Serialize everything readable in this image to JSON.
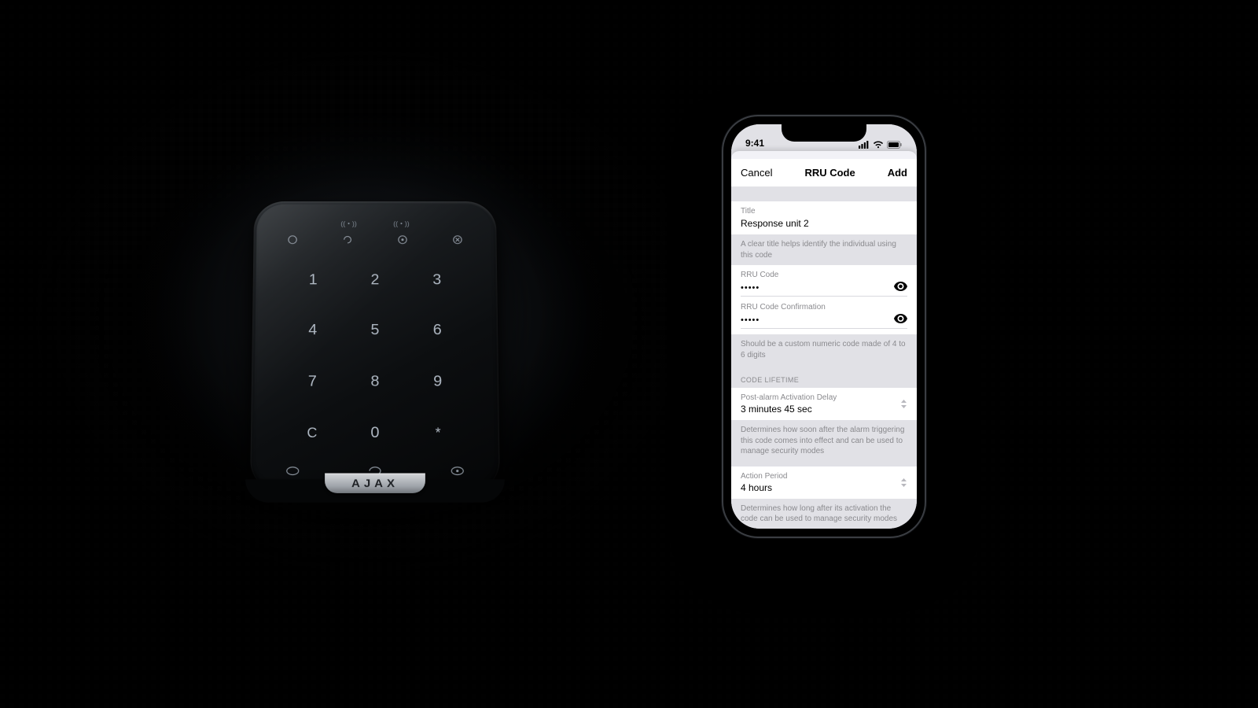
{
  "statusbar": {
    "time": "9:41"
  },
  "keypad": {
    "brand": "AJAX",
    "keys": {
      "k1": "1",
      "k2": "2",
      "k3": "3",
      "k4": "4",
      "k5": "5",
      "k6": "6",
      "k7": "7",
      "k8": "8",
      "k9": "9",
      "kc": "C",
      "k0": "0",
      "kstar": "*"
    }
  },
  "modal": {
    "cancel": "Cancel",
    "title": "RRU Code",
    "add": "Add",
    "title_field": {
      "label": "Title",
      "value": "Response unit 2"
    },
    "title_hint": "A clear title helps identify the individual using this code",
    "code_field": {
      "label": "RRU Code",
      "value_masked": "•••••"
    },
    "code_confirm_field": {
      "label": "RRU Code Confirmation",
      "value_masked": "•••••"
    },
    "code_hint": "Should be a custom numeric code made of 4 to 6 digits",
    "lifetime_header": "CODE LIFETIME",
    "delay": {
      "label": "Post-alarm Activation Delay",
      "value": "3 minutes 45 sec"
    },
    "delay_hint": "Determines how soon after the alarm triggering this code comes into effect and can be used to manage security modes",
    "action": {
      "label": "Action Period",
      "value": "4 hours"
    },
    "action_hint": "Determines how long after its activation the code can be used to manage security modes"
  }
}
